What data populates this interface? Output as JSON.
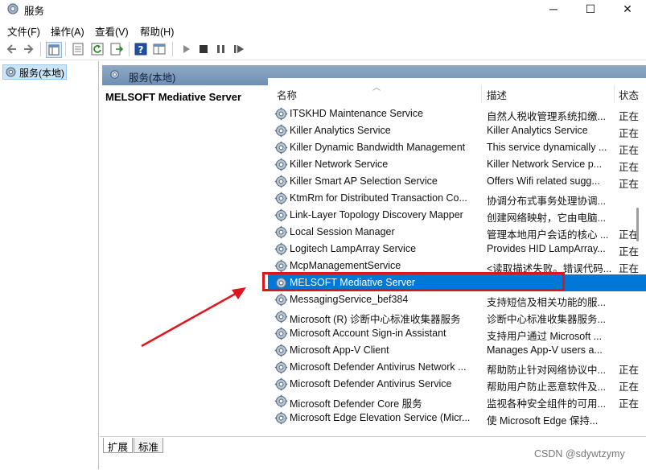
{
  "window": {
    "title": "服务",
    "minimize_glyph": "─",
    "maximize_glyph": "☐",
    "close_glyph": "✕"
  },
  "menu": [
    "文件(F)",
    "操作(A)",
    "查看(V)",
    "帮助(H)"
  ],
  "left_tree": {
    "item": "服务(本地)"
  },
  "right_header": {
    "label": "服务(本地)"
  },
  "detail": {
    "title": "MELSOFT Mediative Server"
  },
  "columns": {
    "name": "名称",
    "desc": "描述",
    "status": "状态"
  },
  "rows": [
    {
      "name": "ITSKHD Maintenance Service",
      "desc": "自然人税收管理系统扣缴...",
      "status": "正在"
    },
    {
      "name": "Killer Analytics Service",
      "desc": "Killer Analytics Service",
      "status": "正在"
    },
    {
      "name": "Killer Dynamic Bandwidth Management",
      "desc": "This service dynamically ...",
      "status": "正在"
    },
    {
      "name": "Killer Network Service",
      "desc": "Killer Network Service p...",
      "status": "正在"
    },
    {
      "name": "Killer Smart AP Selection Service",
      "desc": "Offers Wifi related sugg...",
      "status": "正在"
    },
    {
      "name": "KtmRm for Distributed Transaction Co...",
      "desc": "协调分布式事务处理协调...",
      "status": ""
    },
    {
      "name": "Link-Layer Topology Discovery Mapper",
      "desc": "创建网络映射，它由电脑...",
      "status": ""
    },
    {
      "name": "Local Session Manager",
      "desc": "管理本地用户会话的核心 ...",
      "status": "正在"
    },
    {
      "name": "Logitech LampArray Service",
      "desc": "Provides HID LampArray...",
      "status": "正在"
    },
    {
      "name": "McpManagementService",
      "desc": "<读取描述失败。错误代码...",
      "status": "正在"
    },
    {
      "name": "MELSOFT Mediative Server",
      "desc": "",
      "status": ""
    },
    {
      "name": "MessagingService_bef384",
      "desc": "支持短信及相关功能的服...",
      "status": ""
    },
    {
      "name": "Microsoft (R) 诊断中心标准收集器服务",
      "desc": "诊断中心标准收集器服务...",
      "status": ""
    },
    {
      "name": "Microsoft Account Sign-in Assistant",
      "desc": "支持用户通过 Microsoft ...",
      "status": ""
    },
    {
      "name": "Microsoft App-V Client",
      "desc": "Manages App-V users a...",
      "status": ""
    },
    {
      "name": "Microsoft Defender Antivirus Network ...",
      "desc": "帮助防止针对网络协议中...",
      "status": "正在"
    },
    {
      "name": "Microsoft Defender Antivirus Service",
      "desc": "帮助用户防止恶意软件及...",
      "status": "正在"
    },
    {
      "name": "Microsoft Defender Core 服务",
      "desc": "监视各种安全组件的可用...",
      "status": "正在"
    },
    {
      "name": "Microsoft Edge Elevation Service (Micr...",
      "desc": "使 Microsoft Edge 保持...",
      "status": ""
    }
  ],
  "tabs": [
    "扩展",
    "标准"
  ],
  "watermark": "CSDN @sdywtzymy",
  "colors": {
    "selection": "#0078d7",
    "highlight_box": "#e0141c",
    "header_band": "#7f9cbd"
  }
}
